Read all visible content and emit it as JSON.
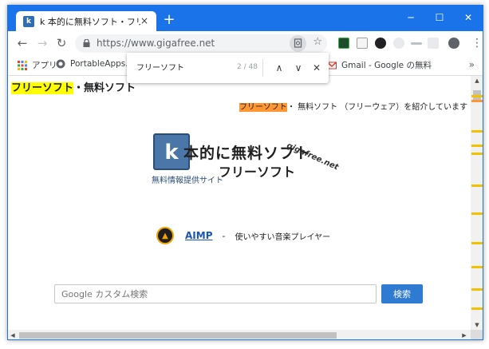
{
  "browser": {
    "tab": {
      "title": "k 本的に無料ソフト・フリーソフト",
      "favicon_letter": "k",
      "close_glyph": "×"
    },
    "new_tab_glyph": "+",
    "window_controls": {
      "minimize": "─",
      "maximize": "☐",
      "close": "✕"
    },
    "toolbar": {
      "back_glyph": "←",
      "forward_glyph": "→",
      "reload_glyph": "↻",
      "url": "https://www.gigafree.net",
      "star_glyph": "☆",
      "menu_glyph": "⋮"
    },
    "bookmarks": [
      {
        "label": "アプリ",
        "icon": "apps-grid-icon"
      },
      {
        "label": "PortableApps.com",
        "icon": "portableapps-icon"
      },
      {
        "label": "Gmail - Google の無料",
        "icon": "gmail-icon"
      }
    ],
    "bookmarks_more": "»",
    "find_bar": {
      "query": "フリーソフト",
      "count": "2 / 48",
      "prev_glyph": "∧",
      "next_glyph": "∨",
      "close_glyph": "✕"
    }
  },
  "page": {
    "heading_highlight": "フリーソフト",
    "heading_rest": "・無料ソフト",
    "tagline_highlight": "フリーソフト",
    "tagline_rest": "・ 無料ソフト （フリーウェア）を紹介しています",
    "logo": {
      "box_letter": "k",
      "line1": "本的に無料ソフト",
      "line2": "フリーソフト",
      "subtitle": "無料情報提供サイト",
      "site": "gigafree.net"
    },
    "featured": {
      "icon_glyph": "▲",
      "name": "AIMP",
      "dash": "-",
      "description": "使いやすい音楽プレイヤー"
    },
    "search": {
      "placeholder": "Google カスタム検索",
      "button": "検索"
    }
  },
  "scrollbar": {
    "up_glyph": "▲",
    "down_glyph": "▼",
    "left_glyph": "◀",
    "right_glyph": "▶"
  },
  "colors": {
    "titlebar": "#1a73e8",
    "find_highlight_active": "#ff9632",
    "find_highlight": "#ffff00",
    "link": "#1a55b4",
    "search_button": "#2f7bd1"
  }
}
